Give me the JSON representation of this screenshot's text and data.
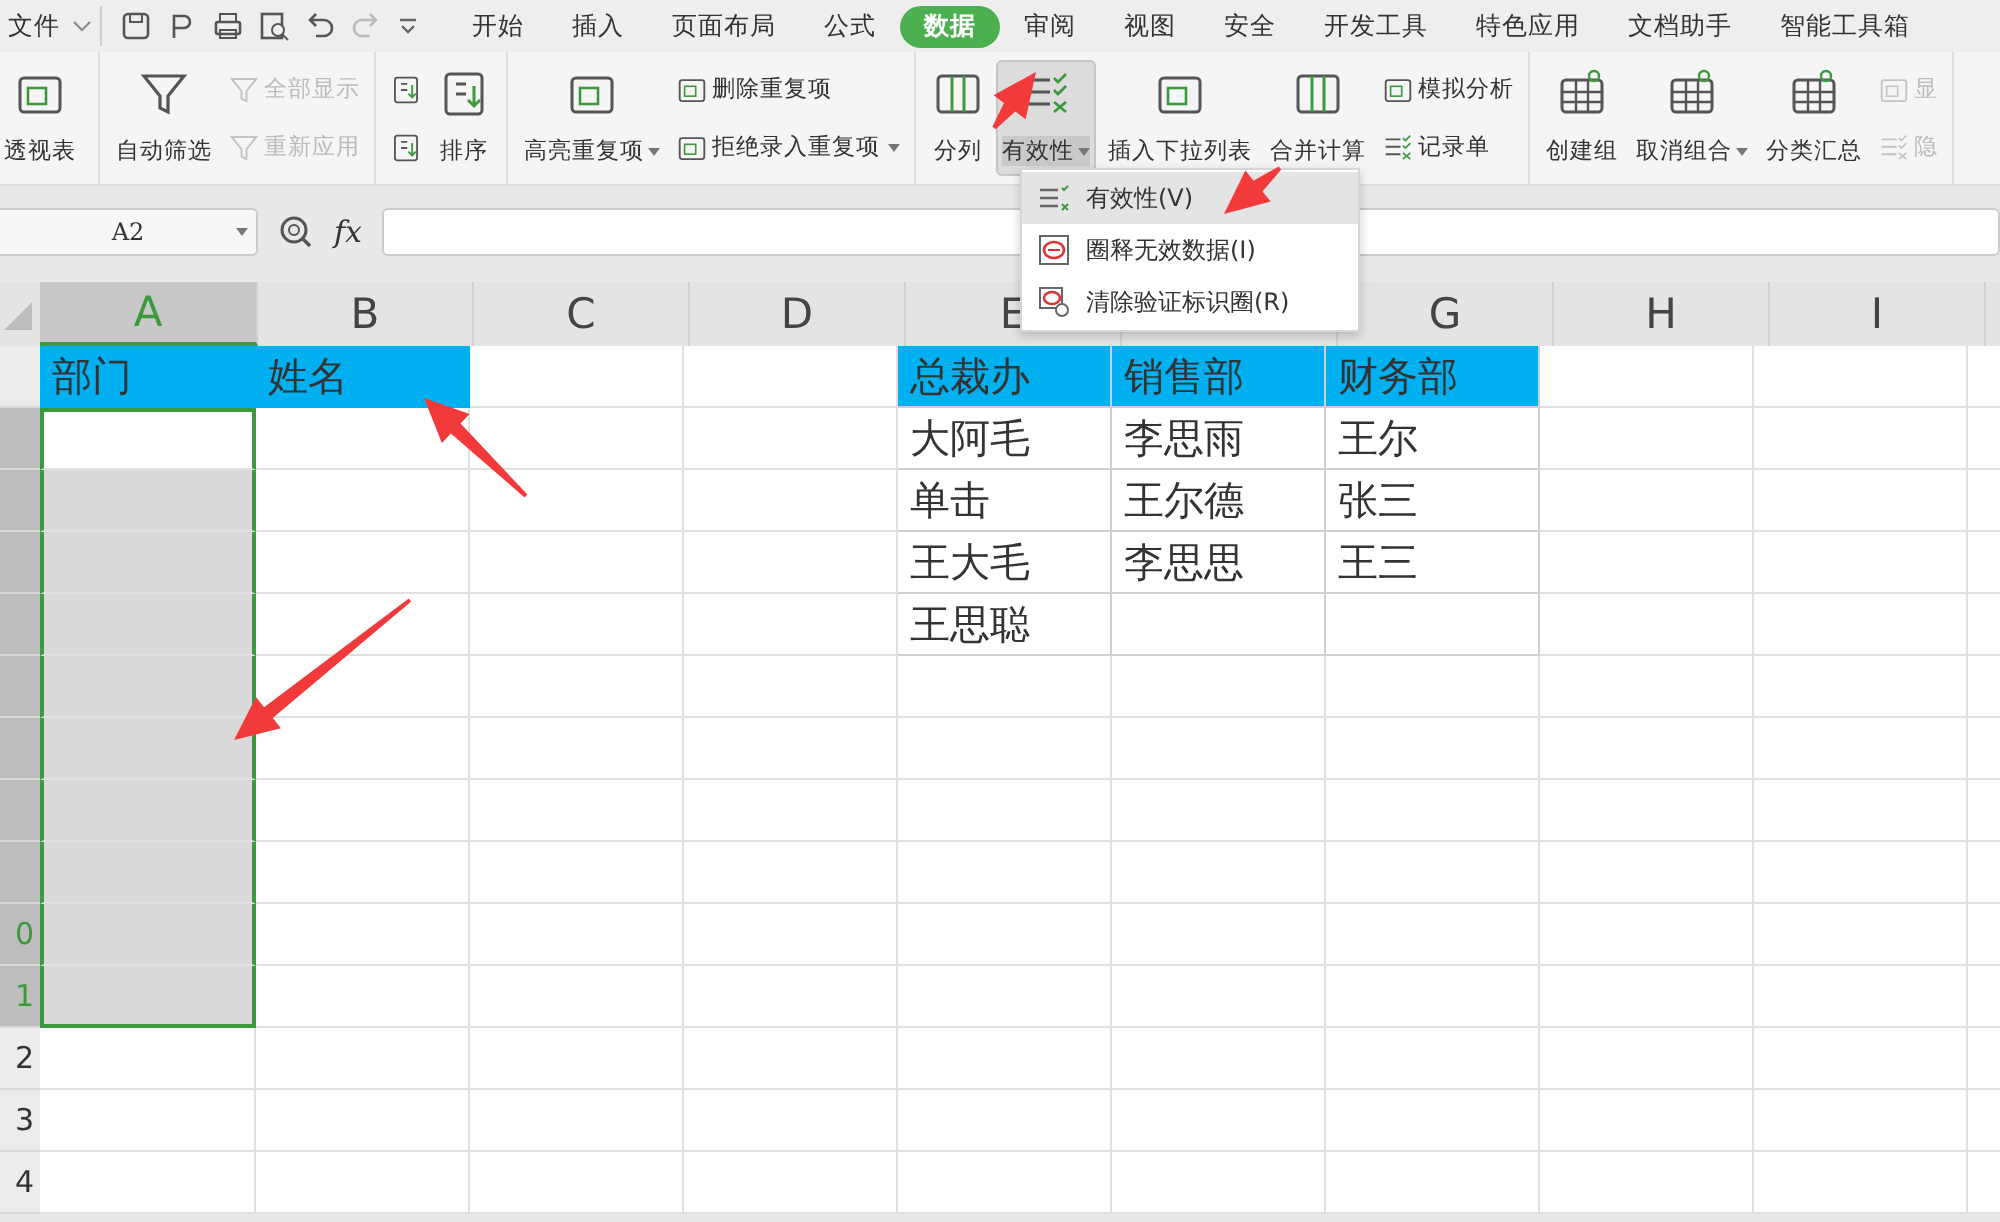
{
  "menu_bar": {
    "file_menu": "文件",
    "tabs": [
      {
        "label": "开始",
        "selected": false
      },
      {
        "label": "插入",
        "selected": false
      },
      {
        "label": "页面布局",
        "selected": false
      },
      {
        "label": "公式",
        "selected": false
      },
      {
        "label": "数据",
        "selected": true
      },
      {
        "label": "审阅",
        "selected": false
      },
      {
        "label": "视图",
        "selected": false
      },
      {
        "label": "安全",
        "selected": false
      },
      {
        "label": "开发工具",
        "selected": false
      },
      {
        "label": "特色应用",
        "selected": false
      },
      {
        "label": "文档助手",
        "selected": false
      },
      {
        "label": "智能工具箱",
        "selected": false
      }
    ]
  },
  "ribbon": {
    "groups": [
      {
        "items": [
          {
            "kind": "large",
            "label": "透视表",
            "disabled": false,
            "pressed": false,
            "dropdown": false
          }
        ]
      },
      {
        "items": [
          {
            "kind": "large",
            "label": "自动筛选",
            "disabled": false,
            "pressed": false,
            "dropdown": false
          },
          {
            "kind": "small",
            "label": "全部显示",
            "disabled": true,
            "dropdown": false
          },
          {
            "kind": "small",
            "label": "重新应用",
            "disabled": true,
            "dropdown": false
          }
        ]
      },
      {
        "items": [
          {
            "kind": "icon",
            "disabled": false
          },
          {
            "kind": "icon",
            "disabled": false
          },
          {
            "kind": "large",
            "label": "排序",
            "disabled": false,
            "pressed": false,
            "dropdown": false
          }
        ]
      },
      {
        "items": [
          {
            "kind": "large",
            "label": "高亮重复项",
            "disabled": false,
            "pressed": false,
            "dropdown": true
          },
          {
            "kind": "small",
            "label": "删除重复项",
            "disabled": false,
            "dropdown": false
          },
          {
            "kind": "small",
            "label": "拒绝录入重复项",
            "disabled": false,
            "dropdown": true
          }
        ]
      },
      {
        "items": [
          {
            "kind": "large",
            "label": "分列",
            "disabled": false,
            "pressed": false,
            "dropdown": false
          },
          {
            "kind": "large",
            "label": "有效性",
            "disabled": false,
            "pressed": true,
            "dropdown": true
          },
          {
            "kind": "large",
            "label": "插入下拉列表",
            "disabled": false,
            "pressed": false,
            "dropdown": false
          },
          {
            "kind": "large",
            "label": "合并计算",
            "disabled": false,
            "pressed": false,
            "dropdown": false
          },
          {
            "kind": "small",
            "label": "模拟分析",
            "disabled": false,
            "dropdown": false
          },
          {
            "kind": "small",
            "label": "记录单",
            "disabled": false,
            "dropdown": false
          }
        ]
      },
      {
        "items": [
          {
            "kind": "large",
            "label": "创建组",
            "disabled": false,
            "pressed": false,
            "dropdown": false
          },
          {
            "kind": "large",
            "label": "取消组合",
            "disabled": false,
            "pressed": false,
            "dropdown": true
          },
          {
            "kind": "large",
            "label": "分类汇总",
            "disabled": false,
            "pressed": false,
            "dropdown": false
          },
          {
            "kind": "small",
            "label": "显",
            "disabled": true,
            "dropdown": false
          },
          {
            "kind": "small",
            "label": "隐",
            "disabled": true,
            "dropdown": false
          }
        ]
      }
    ]
  },
  "dropdown_menu": {
    "items": [
      {
        "label": "有效性(V)",
        "selected": true
      },
      {
        "label": "圈释无效数据(I)",
        "selected": false
      },
      {
        "label": "清除验证标识圈(R)",
        "selected": false
      }
    ]
  },
  "formula_bar": {
    "name_box": "A2",
    "fx": "fx"
  },
  "columns": [
    {
      "label": "A",
      "selected": true
    },
    {
      "label": "B",
      "selected": false
    },
    {
      "label": "C",
      "selected": false
    },
    {
      "label": "D",
      "selected": false
    },
    {
      "label": "E",
      "selected": false
    },
    {
      "selected": false
    },
    {
      "label": "G",
      "selected": false
    },
    {
      "label": "H",
      "selected": false
    },
    {
      "label": "I",
      "selected": false
    }
  ],
  "rows": [
    {
      "selected": false,
      "cells": {
        "A": {
          "text": "部门",
          "filled": true
        },
        "B": {
          "text": "姓名",
          "filled": true
        },
        "E": {
          "text": "总裁办",
          "filled": true,
          "bordered": true
        },
        "F": {
          "text": "销售部",
          "filled": true,
          "bordered": true
        },
        "G": {
          "text": "财务部",
          "filled": true,
          "bordered": true
        }
      }
    },
    {
      "selected": true,
      "cells": {
        "A": {
          "selected": true,
          "active": true
        },
        "E": {
          "text": "大阿毛",
          "bordered": true
        },
        "F": {
          "text": "李思雨",
          "bordered": true
        },
        "G": {
          "text": "王尔",
          "bordered": true
        }
      }
    },
    {
      "selected": true,
      "cells": {
        "A": {
          "selected": true,
          "active": false
        },
        "E": {
          "text": "单击",
          "bordered": true
        },
        "F": {
          "text": "王尔德",
          "bordered": true
        },
        "G": {
          "text": "张三",
          "bordered": true
        }
      }
    },
    {
      "selected": true,
      "cells": {
        "A": {
          "selected": true,
          "active": false
        },
        "E": {
          "text": "王大毛",
          "bordered": true
        },
        "F": {
          "text": "李思思",
          "bordered": true
        },
        "G": {
          "text": "王三",
          "bordered": true
        }
      }
    },
    {
      "selected": true,
      "cells": {
        "A": {
          "selected": true,
          "active": false
        },
        "E": {
          "text": "王思聪",
          "bordered": true
        },
        "F": {
          "bordered": true
        },
        "G": {
          "bordered": true
        }
      }
    },
    {
      "selected": true,
      "cells": {
        "A": {
          "selected": true,
          "active": false
        }
      }
    },
    {
      "selected": true,
      "cells": {
        "A": {
          "selected": true,
          "active": false
        }
      }
    },
    {
      "selected": true,
      "cells": {
        "A": {
          "selected": true,
          "active": false
        }
      }
    },
    {
      "selected": true,
      "cells": {
        "A": {
          "selected": true,
          "active": false
        }
      }
    },
    {
      "label": "0",
      "selected": true,
      "cells": {
        "A": {
          "selected": true,
          "active": false
        }
      }
    },
    {
      "label": "1",
      "selected": true,
      "cells": {
        "A": {
          "selected": true,
          "active": false
        }
      }
    },
    {
      "label": "2",
      "selected": false,
      "cells": {}
    },
    {
      "label": "3",
      "selected": false,
      "cells": {}
    },
    {
      "label": "4",
      "selected": false,
      "cells": {}
    }
  ]
}
